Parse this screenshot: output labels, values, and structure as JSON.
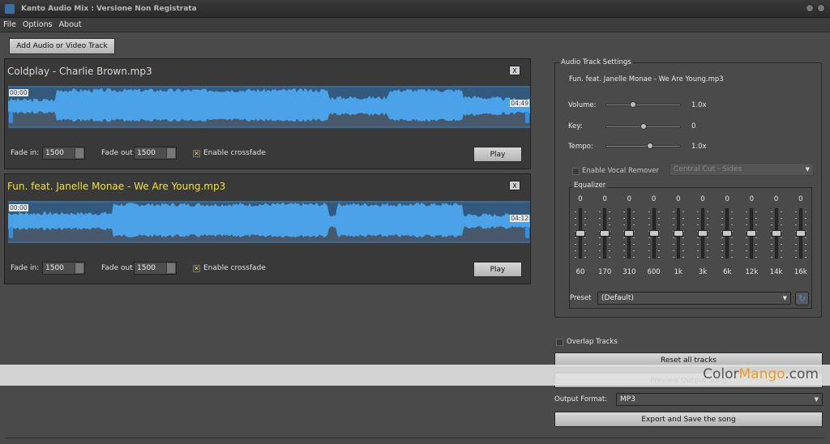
{
  "window": {
    "title": "Kanto Audio Mix : Versione Non Registrata"
  },
  "menu": [
    "File",
    "Options",
    "About"
  ],
  "toolbar": {
    "add_label": "Add Audio or Video Track"
  },
  "tracks": [
    {
      "title": "Coldplay - Charlie Brown.mp3",
      "close": "X",
      "start_time": "00:00",
      "end_time": "04:49",
      "fade_in_label": "Fade in:",
      "fade_in": "1500",
      "fade_out_label": "Fade out:",
      "fade_out": "1500",
      "crossfade_label": "Enable crossfade",
      "crossfade_mark": "✕",
      "play_label": "Play"
    },
    {
      "title": "Fun. feat. Janelle Monae - We Are Young.mp3",
      "close": "X",
      "start_time": "00:00",
      "end_time": "04:12",
      "fade_in_label": "Fade in:",
      "fade_in": "1500",
      "fade_out_label": "Fade out:",
      "fade_out": "1500",
      "crossfade_label": "Enable crossfade",
      "crossfade_mark": "✕",
      "play_label": "Play"
    }
  ],
  "settings": {
    "caption": "Audio Track Settings",
    "track_name": "Fun. feat. Janelle Monae - We Are Young.mp3",
    "volume_label": "Volume:",
    "volume_value": "1.0x",
    "volume_level": 0.35,
    "key_label": "Key:",
    "key_value": "0",
    "key_level": 0.5,
    "tempo_label": "Tempo:",
    "tempo_value": "1.0x",
    "tempo_level": 0.6,
    "vocal_label": "Enable Vocal Remover",
    "vocal_mode": "Central Cut - Sides",
    "equalizer_caption": "Equalizer",
    "eq_bands": [
      {
        "freq": "60",
        "gain": "0"
      },
      {
        "freq": "170",
        "gain": "0"
      },
      {
        "freq": "310",
        "gain": "0"
      },
      {
        "freq": "600",
        "gain": "0"
      },
      {
        "freq": "1k",
        "gain": "0"
      },
      {
        "freq": "3k",
        "gain": "0"
      },
      {
        "freq": "6k",
        "gain": "0"
      },
      {
        "freq": "12k",
        "gain": "0"
      },
      {
        "freq": "14k",
        "gain": "0"
      },
      {
        "freq": "16k",
        "gain": "0"
      }
    ],
    "preset_label": "Preset",
    "preset_value": "(Default)",
    "refresh_icon": "↻"
  },
  "output": {
    "overlap_label": "Overlap Tracks",
    "reset_label": "Reset all tracks",
    "preview_label": "Preview Output Song",
    "format_label": "Output Format:",
    "format_value": "MP3",
    "export_label": "Export and Save the song"
  },
  "watermark": {
    "prefix": "Color",
    "accent": "Mango",
    "suffix": ".com"
  },
  "colors": {
    "wave": "#4aa3e8",
    "wave_dark": "#2e6fa8",
    "active_title": "#f0e33a",
    "accent": "#3b8ee8"
  }
}
